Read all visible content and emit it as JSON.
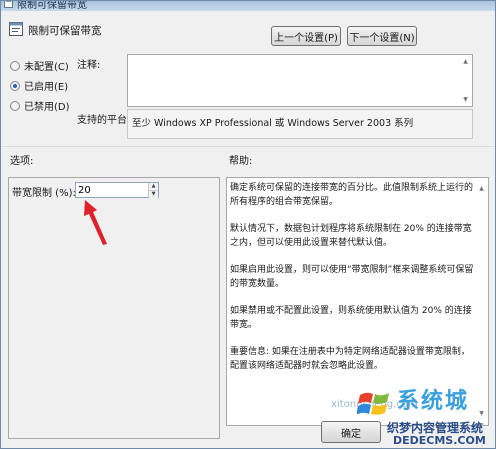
{
  "window": {
    "title": "限制可保留带宽"
  },
  "header": {
    "policy_title": "限制可保留带宽"
  },
  "nav": {
    "prev_label": "上一个设置(P)",
    "next_label": "下一个设置(N)"
  },
  "state": {
    "options": [
      {
        "label": "未配置(C)",
        "checked": false
      },
      {
        "label": "已启用(E)",
        "checked": true
      },
      {
        "label": "已禁用(D)",
        "checked": false
      }
    ]
  },
  "comment": {
    "label": "注释:",
    "value": ""
  },
  "platform": {
    "label": "支持的平台:",
    "value": "至少 Windows XP Professional 或 Windows Server 2003 系列"
  },
  "sections": {
    "options_heading": "选项:",
    "help_heading": "帮助:"
  },
  "options": {
    "bandwidth_label": "带宽限制 (%):",
    "bandwidth_value": "20"
  },
  "help": {
    "paragraphs": [
      "确定系统可保留的连接带宽的百分比。此值限制系统上运行的所有程序的组合带宽保留。",
      "默认情况下，数据包计划程序将系统限制在 20% 的连接带宽之内，但可以使用此设置来替代默认值。",
      "如果启用此设置，则可以使用“带宽限制”框来调整系统可保留的带宽数量。",
      "如果禁用或不配置此设置，则系统使用默认值为 20% 的连接带宽。",
      "重要信息: 如果在注册表中为特定网络适配器设置带宽限制，配置该网络适配器时就会忽略此设置。"
    ]
  },
  "footer": {
    "ok_label": "确定"
  },
  "watermark": {
    "brand": "系统城",
    "faint_text": "xitongcheng.com",
    "site_cn": "织梦内容管理系统",
    "site_url": "DEDECMS.COM"
  },
  "colors": {
    "accent": "#2a60b8",
    "annotation_arrow": "#e0202a",
    "watermark_blue": "#3aa0dc"
  }
}
